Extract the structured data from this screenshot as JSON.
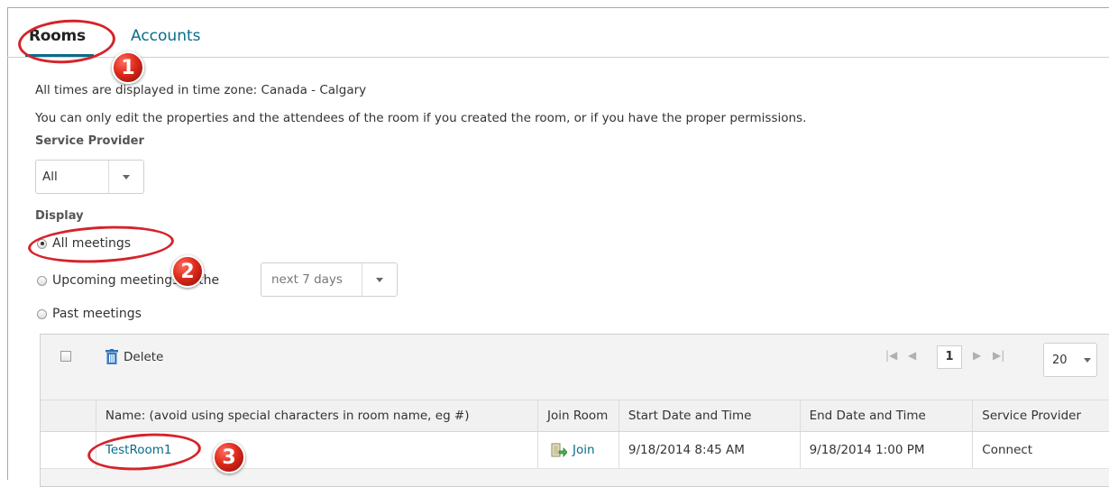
{
  "tabs": {
    "rooms": "Rooms",
    "accounts": "Accounts"
  },
  "info": {
    "timezone": "All times are displayed in time zone: Canada - Calgary",
    "permissions": "You can only edit the properties and the attendees of the room if you created the room, or if you have the proper permissions."
  },
  "service_provider": {
    "label": "Service Provider",
    "value": "All"
  },
  "display": {
    "label": "Display",
    "all_meetings": "All meetings",
    "upcoming": "Upcoming meetings in the",
    "upcoming_range": "next 7 days",
    "past_meetings": "Past meetings",
    "selected": "All meetings"
  },
  "toolbar": {
    "delete_label": "Delete",
    "page": "1",
    "page_size": "20"
  },
  "table": {
    "headers": {
      "name": "Name: (avoid using special characters in room name, eg #)",
      "join": "Join Room",
      "start": "Start Date and Time",
      "end": "End Date and Time",
      "provider": "Service Provider"
    },
    "rows": [
      {
        "name": "TestRoom1",
        "join": "Join",
        "start": "9/18/2014 8:45 AM",
        "end": "9/18/2014 1:00 PM",
        "provider": "Connect"
      }
    ]
  },
  "callouts": [
    "1",
    "2",
    "3"
  ],
  "colors": {
    "accent": "#0a6c8a",
    "callout": "#d5232a"
  }
}
